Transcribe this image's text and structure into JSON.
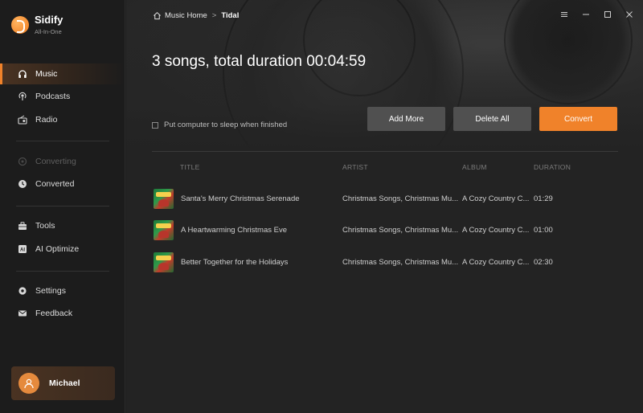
{
  "app": {
    "name": "Sidify",
    "subtitle": "All-In-One"
  },
  "sidebar": {
    "items": [
      {
        "label": "Music",
        "icon": "headphones-icon",
        "active": true
      },
      {
        "label": "Podcasts",
        "icon": "podcast-icon"
      },
      {
        "label": "Radio",
        "icon": "radio-icon"
      },
      {
        "label": "Converting",
        "icon": "converting-icon",
        "disabled": true
      },
      {
        "label": "Converted",
        "icon": "clock-icon"
      },
      {
        "label": "Tools",
        "icon": "toolbox-icon"
      },
      {
        "label": "AI Optimize",
        "icon": "ai-icon"
      },
      {
        "label": "Settings",
        "icon": "gear-icon"
      },
      {
        "label": "Feedback",
        "icon": "mail-icon"
      }
    ],
    "user": {
      "name": "Michael"
    }
  },
  "header": {
    "breadcrumb": {
      "home": "Music Home",
      "separator": ">",
      "current": "Tidal"
    },
    "title": "3 songs, total duration 00:04:59"
  },
  "options": {
    "sleep_label": "Put computer to sleep when finished",
    "sleep_checked": false
  },
  "actions": {
    "add_more": "Add More",
    "delete_all": "Delete All",
    "convert": "Convert"
  },
  "table": {
    "columns": {
      "title": "TITLE",
      "artist": "ARTIST",
      "album": "ALBUM",
      "duration": "DURATION"
    },
    "rows": [
      {
        "title": "Santa's Merry Christmas Serenade",
        "artist": "Christmas Songs, Christmas Mu...",
        "album": "A Cozy Country C...",
        "duration": "01:29"
      },
      {
        "title": "A Heartwarming Christmas Eve",
        "artist": "Christmas Songs, Christmas Mu...",
        "album": "A Cozy Country C...",
        "duration": "01:00"
      },
      {
        "title": "Better Together for the Holidays",
        "artist": "Christmas Songs, Christmas Mu...",
        "album": "A Cozy Country C...",
        "duration": "02:30"
      }
    ]
  },
  "colors": {
    "accent": "#f0822a",
    "background": "#232323",
    "sidebar": "#1c1c1c"
  }
}
